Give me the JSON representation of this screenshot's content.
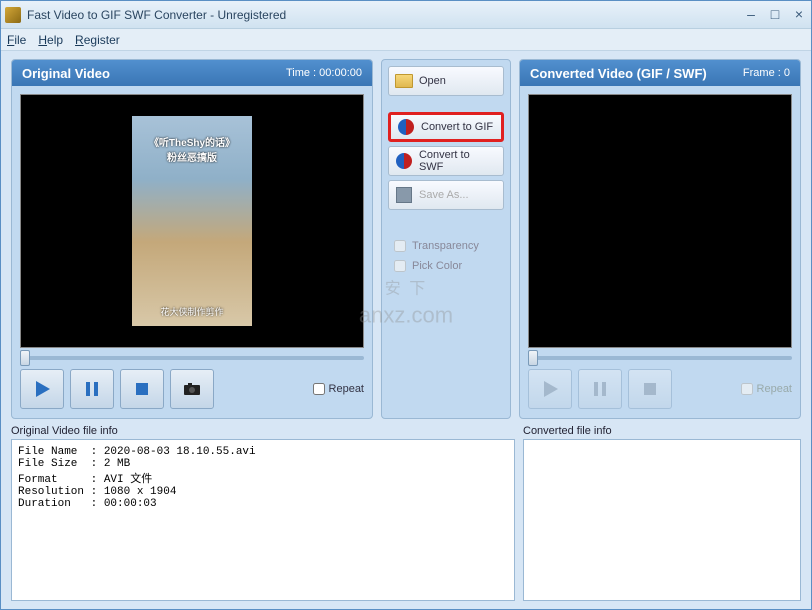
{
  "window": {
    "title": "Fast Video to GIF SWF Converter - Unregistered"
  },
  "menu": {
    "file": "File",
    "help": "Help",
    "register": "Register"
  },
  "leftPanel": {
    "title": "Original Video",
    "time_label": "Time : ",
    "time_value": "00:00:00",
    "repeat": "Repeat",
    "thumb_top": "《听TheShy的话》",
    "thumb_mid": "粉丝恶搞版",
    "thumb_bot": "花大侠制作剪作"
  },
  "rightPanel": {
    "title": "Converted Video (GIF / SWF)",
    "frame_label": "Frame : ",
    "frame_value": "0",
    "repeat": "Repeat"
  },
  "mid": {
    "open": "Open",
    "to_gif": "Convert to GIF",
    "to_swf": "Convert to SWF",
    "save_as": "Save As...",
    "transparency": "Transparency",
    "pick_color": "Pick Color"
  },
  "info": {
    "left_label": "Original Video file info",
    "right_label": "Converted file info",
    "left_text": "File Name  : 2020-08-03 18.10.55.avi\nFile Size  : 2 MB\nFormat     : AVI 文件\nResolution : 1080 x 1904\nDuration   : 00:00:03"
  },
  "watermark": {
    "line1": "安 下",
    "line2": "anxz.com"
  }
}
